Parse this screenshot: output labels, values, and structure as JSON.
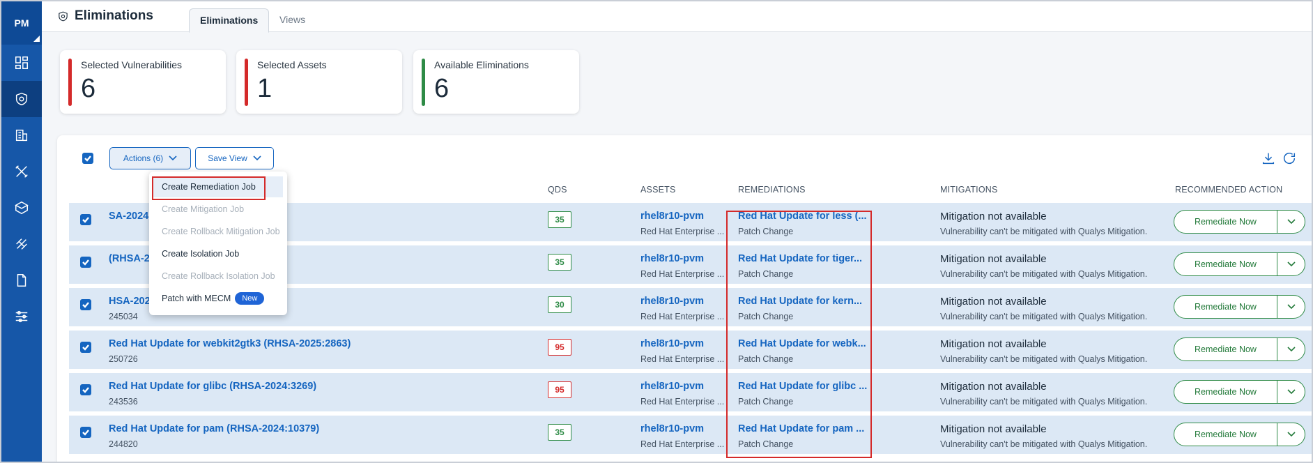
{
  "user_initials": "PM",
  "page": {
    "title": "Eliminations",
    "tabs": [
      "Eliminations",
      "Views"
    ]
  },
  "cards": [
    {
      "label": "Selected Vulnerabilities",
      "value": "6",
      "color": "#d42a2a"
    },
    {
      "label": "Selected Assets",
      "value": "1",
      "color": "#d42a2a"
    },
    {
      "label": "Available Eliminations",
      "value": "6",
      "color": "#2e8b46"
    }
  ],
  "toolbar": {
    "actions_label": "Actions (6)",
    "save_view_label": "Save View"
  },
  "columns": {
    "qds": "QDS",
    "assets": "ASSETS",
    "remediations": "REMEDIATIONS",
    "mitigations": "MITIGATIONS",
    "recommended": "RECOMMENDED ACTION"
  },
  "menu": [
    {
      "label": "Create Remediation Job",
      "disabled": false
    },
    {
      "label": "Create Mitigation Job",
      "disabled": true
    },
    {
      "label": "Create Rollback Mitigation Job",
      "disabled": true
    },
    {
      "label": "Create Isolation Job",
      "disabled": false
    },
    {
      "label": "Create Rollback Isolation Job",
      "disabled": true
    },
    {
      "label": "Patch with MECM",
      "disabled": false,
      "badge": "New"
    }
  ],
  "rows": [
    {
      "name": "SA-2024:4256)",
      "id": "",
      "qds": "35",
      "qds_color": "#2e8b46",
      "asset": "rhel8r10-pvm",
      "asset_sub": "Red Hat Enterprise ...",
      "rem": "Red Hat Update for less (...",
      "rem_sub": "Patch Change",
      "mit": "Mitigation not available",
      "mit_sub": "Vulnerability can't be mitigated with Qualys Mitigation.",
      "action": "Remediate Now"
    },
    {
      "name": "(RHSA-2025:2502)",
      "id": "",
      "qds": "35",
      "qds_color": "#2e8b46",
      "asset": "rhel8r10-pvm",
      "asset_sub": "Red Hat Enterprise ...",
      "rem": "Red Hat Update for tiger...",
      "rem_sub": "Patch Change",
      "mit": "Mitigation not available",
      "mit_sub": "Vulnerability can't be mitigated with Qualys Mitigation.",
      "action": "Remediate Now"
    },
    {
      "name": "HSA-2025:0065)",
      "id": "245034",
      "qds": "30",
      "qds_color": "#2e8b46",
      "asset": "rhel8r10-pvm",
      "asset_sub": "Red Hat Enterprise ...",
      "rem": "Red Hat Update for kern...",
      "rem_sub": "Patch Change",
      "mit": "Mitigation not available",
      "mit_sub": "Vulnerability can't be mitigated with Qualys Mitigation.",
      "action": "Remediate Now"
    },
    {
      "name": "Red Hat Update for webkit2gtk3 (RHSA-2025:2863)",
      "id": "250726",
      "qds": "95",
      "qds_color": "#d42a2a",
      "asset": "rhel8r10-pvm",
      "asset_sub": "Red Hat Enterprise ...",
      "rem": "Red Hat Update for webk...",
      "rem_sub": "Patch Change",
      "mit": "Mitigation not available",
      "mit_sub": "Vulnerability can't be mitigated with Qualys Mitigation.",
      "action": "Remediate Now"
    },
    {
      "name": "Red Hat Update for glibc (RHSA-2024:3269)",
      "id": "243536",
      "qds": "95",
      "qds_color": "#d42a2a",
      "asset": "rhel8r10-pvm",
      "asset_sub": "Red Hat Enterprise ...",
      "rem": "Red Hat Update for glibc ...",
      "rem_sub": "Patch Change",
      "mit": "Mitigation not available",
      "mit_sub": "Vulnerability can't be mitigated with Qualys Mitigation.",
      "action": "Remediate Now"
    },
    {
      "name": "Red Hat Update for pam (RHSA-2024:10379)",
      "id": "244820",
      "qds": "35",
      "qds_color": "#2e8b46",
      "asset": "rhel8r10-pvm",
      "asset_sub": "Red Hat Enterprise ...",
      "rem": "Red Hat Update for pam ...",
      "rem_sub": "Patch Change",
      "mit": "Mitigation not available",
      "mit_sub": "Vulnerability can't be mitigated with Qualys Mitigation.",
      "action": "Remediate Now"
    }
  ]
}
